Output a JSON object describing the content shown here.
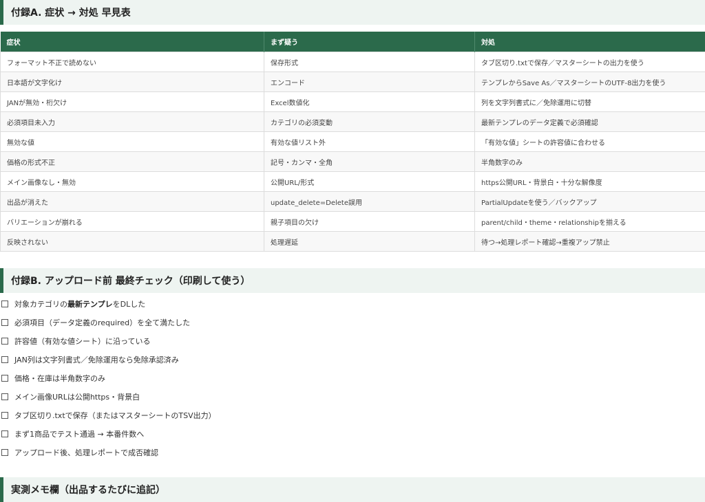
{
  "appendix_a": {
    "title": "付録A. 症状 → 対処 早見表",
    "headers": [
      "症状",
      "まず疑う",
      "対処"
    ],
    "rows": [
      [
        "フォーマット不正で読めない",
        "保存形式",
        "タブ区切り.txtで保存／マスターシートの出力を使う"
      ],
      [
        "日本語が文字化け",
        "エンコード",
        "テンプレからSave As／マスターシートのUTF-8出力を使う"
      ],
      [
        "JANが無効・桁欠け",
        "Excel数値化",
        "列を文字列書式に／免除運用に切替"
      ],
      [
        "必須項目未入力",
        "カテゴリの必須変動",
        "最新テンプレのデータ定義で必須確認"
      ],
      [
        "無効な値",
        "有効な値リスト外",
        "「有効な値」シートの許容値に合わせる"
      ],
      [
        "価格の形式不正",
        "記号・カンマ・全角",
        "半角数字のみ"
      ],
      [
        "メイン画像なし・無効",
        "公開URL/形式",
        "https公開URL・背景白・十分な解像度"
      ],
      [
        "出品が消えた",
        "update_delete=Delete誤用",
        "PartialUpdateを使う／バックアップ"
      ],
      [
        "バリエーションが崩れる",
        "親子項目の欠け",
        "parent/child・theme・relationshipを揃える"
      ],
      [
        "反映されない",
        "処理遅延",
        "待つ→処理レポート確認→重複アップ禁止"
      ]
    ]
  },
  "appendix_b": {
    "title": "付録B. アップロード前 最終チェック（印刷して使う）",
    "checkbox_glyph": "☐",
    "items": [
      {
        "pre": "対象カテゴリの",
        "bold": "最新テンプレ",
        "post": "をDLした"
      },
      {
        "pre": "必須項目（データ定義のrequired）を全て満たした",
        "bold": "",
        "post": ""
      },
      {
        "pre": "許容値（有効な値シート）に沿っている",
        "bold": "",
        "post": ""
      },
      {
        "pre": "JAN列は文字列書式／免除運用なら免除承認済み",
        "bold": "",
        "post": ""
      },
      {
        "pre": "価格・在庫は半角数字のみ",
        "bold": "",
        "post": ""
      },
      {
        "pre": "メイン画像URLは公開https・背景白",
        "bold": "",
        "post": ""
      },
      {
        "pre": "タブ区切り.txtで保存（またはマスターシートのTSV出力）",
        "bold": "",
        "post": ""
      },
      {
        "pre": "まず1商品でテスト通過 → 本番件数へ",
        "bold": "",
        "post": ""
      },
      {
        "pre": "アップロード後、処理レポートで成否確認",
        "bold": "",
        "post": ""
      }
    ]
  },
  "memo": {
    "title": "実測メモ欄（出品するたびに追記）"
  },
  "colors": {
    "accent": "#2b6a4b",
    "section_bg": "#eef4f1",
    "row_alt": "#f8f8f8"
  }
}
